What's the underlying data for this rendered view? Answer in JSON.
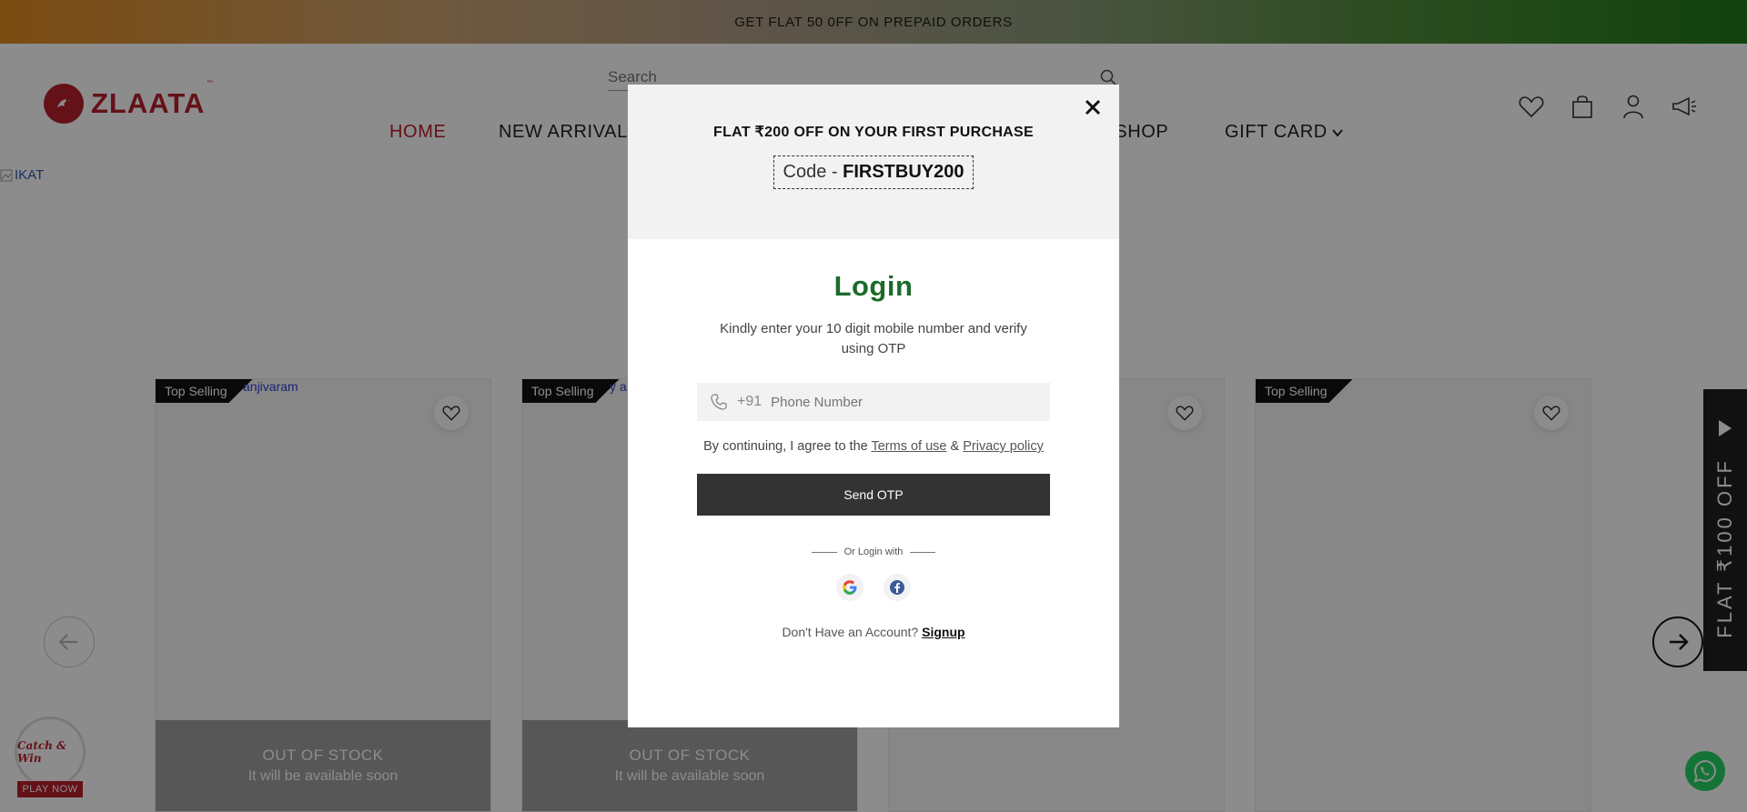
{
  "announcement": {
    "text": "GET FLAT 50 0FF ON PREPAID ORDERS"
  },
  "header": {
    "logo_text": "ZLAATA",
    "logo_tm": "™",
    "search_placeholder": "Search",
    "nav": {
      "home": "HOME",
      "new_arrivals": "NEW ARRIVAL",
      "eshop": "-SHOP",
      "gift_card": "GIFT CARD"
    },
    "icons": [
      "heart-icon",
      "bag-icon",
      "user-icon",
      "megaphone-icon"
    ]
  },
  "banner": {
    "alt_text": "IKAT"
  },
  "products": [
    {
      "badge": "Top Selling",
      "category": "anjivaram",
      "oos_title": "OUT OF STOCK",
      "oos_sub": "It will be available soon"
    },
    {
      "badge": "Top Selling",
      "category": "y a",
      "oos_title": "OUT OF STOCK",
      "oos_sub": "It will be available soon"
    },
    {
      "badge": "",
      "category": "",
      "oos_title": "",
      "oos_sub": ""
    },
    {
      "badge": "Top Selling",
      "category": "",
      "oos_title": "",
      "oos_sub": ""
    }
  ],
  "side_tab": {
    "text": "FLAT ₹100 OFF"
  },
  "catch_win": {
    "title": "Catch & Win",
    "button": "PLAY NOW"
  },
  "modal": {
    "promo_text": "FLAT ₹200 OFF ON YOUR FIRST PURCHASE",
    "code_prefix": "Code - ",
    "code_value": "FIRSTBUY200",
    "title": "Login",
    "subtitle": "Kindly enter your 10 digit mobile number and verify using OTP",
    "phone_prefix": "+91",
    "phone_placeholder": "Phone Number",
    "agree_prefix": "By continuing, I agree to the ",
    "terms_label": "Terms of use",
    "and": " & ",
    "privacy_label": "Privacy policy",
    "send_otp": "Send OTP",
    "or_login_with": "Or Login with",
    "signup_prefix": "Don't Have an Account? ",
    "signup_label": "Signup"
  },
  "colors": {
    "brand": "#b81f2d",
    "login_title": "#1d6b2b",
    "button_dark": "#333333",
    "side_tab": "#1f1f1f"
  }
}
